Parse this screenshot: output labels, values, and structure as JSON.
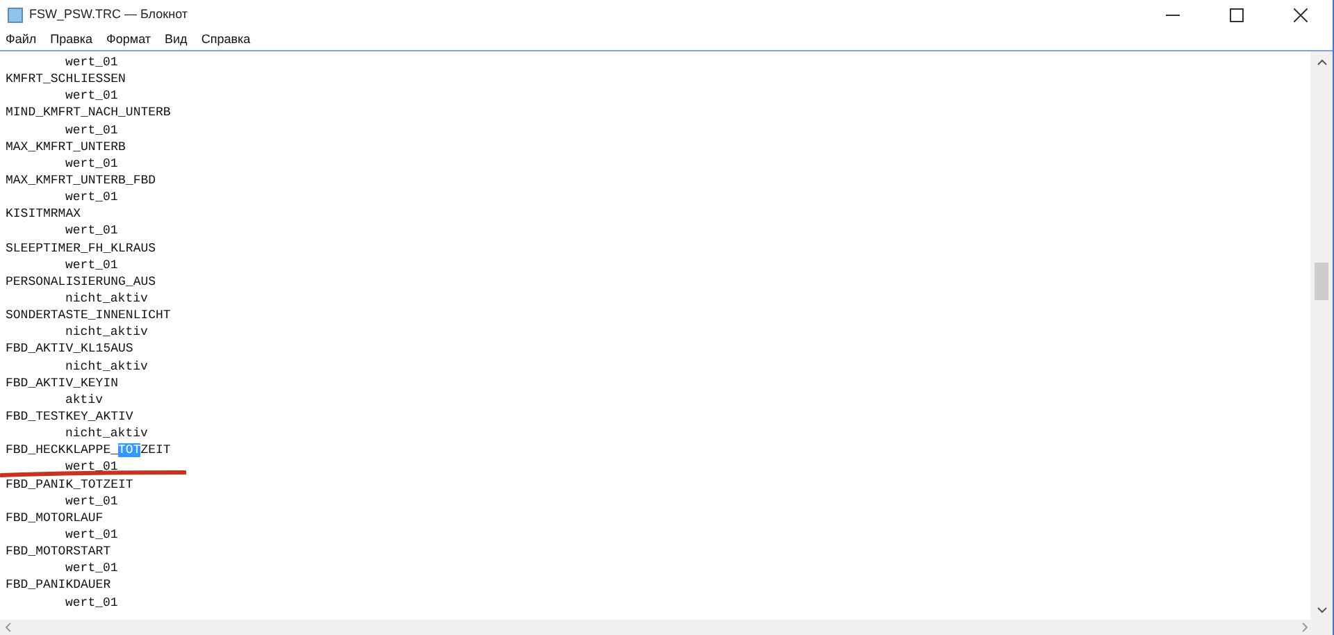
{
  "window": {
    "title": "FSW_PSW.TRC — Блокнот"
  },
  "menu": [
    "Файл",
    "Правка",
    "Формат",
    "Вид",
    "Справка"
  ],
  "lines": [
    {
      "indented": true,
      "marked": false,
      "segments": [
        {
          "text": "wert_01",
          "selected": false
        }
      ]
    },
    {
      "indented": false,
      "marked": false,
      "segments": [
        {
          "text": "KMFRT_SCHLIESSEN",
          "selected": false
        }
      ]
    },
    {
      "indented": true,
      "marked": false,
      "segments": [
        {
          "text": "wert_01",
          "selected": false
        }
      ]
    },
    {
      "indented": false,
      "marked": false,
      "segments": [
        {
          "text": "MIND_KMFRT_NACH_UNTERB",
          "selected": false
        }
      ]
    },
    {
      "indented": true,
      "marked": false,
      "segments": [
        {
          "text": "wert_01",
          "selected": false
        }
      ]
    },
    {
      "indented": false,
      "marked": false,
      "segments": [
        {
          "text": "MAX_KMFRT_UNTERB",
          "selected": false
        }
      ]
    },
    {
      "indented": true,
      "marked": false,
      "segments": [
        {
          "text": "wert_01",
          "selected": false
        }
      ]
    },
    {
      "indented": false,
      "marked": false,
      "segments": [
        {
          "text": "MAX_KMFRT_UNTERB_FBD",
          "selected": false
        }
      ]
    },
    {
      "indented": true,
      "marked": false,
      "segments": [
        {
          "text": "wert_01",
          "selected": false
        }
      ]
    },
    {
      "indented": false,
      "marked": false,
      "segments": [
        {
          "text": "KISITMRMAX",
          "selected": false
        }
      ]
    },
    {
      "indented": true,
      "marked": false,
      "segments": [
        {
          "text": "wert_01",
          "selected": false
        }
      ]
    },
    {
      "indented": false,
      "marked": false,
      "segments": [
        {
          "text": "SLEEPTIMER_FH_KLRAUS",
          "selected": false
        }
      ]
    },
    {
      "indented": true,
      "marked": false,
      "segments": [
        {
          "text": "wert_01",
          "selected": false
        }
      ]
    },
    {
      "indented": false,
      "marked": false,
      "segments": [
        {
          "text": "PERSONALISIERUNG_AUS",
          "selected": false
        }
      ]
    },
    {
      "indented": true,
      "marked": false,
      "segments": [
        {
          "text": "nicht_aktiv",
          "selected": false
        }
      ]
    },
    {
      "indented": false,
      "marked": false,
      "segments": [
        {
          "text": "SONDERTASTE_INNENLICHT",
          "selected": false
        }
      ]
    },
    {
      "indented": true,
      "marked": false,
      "segments": [
        {
          "text": "nicht_aktiv",
          "selected": false
        }
      ]
    },
    {
      "indented": false,
      "marked": false,
      "segments": [
        {
          "text": "FBD_AKTIV_KL15AUS",
          "selected": false
        }
      ]
    },
    {
      "indented": true,
      "marked": false,
      "segments": [
        {
          "text": "nicht_aktiv",
          "selected": false
        }
      ]
    },
    {
      "indented": false,
      "marked": false,
      "segments": [
        {
          "text": "FBD_AKTIV_KEYIN",
          "selected": false
        }
      ]
    },
    {
      "indented": true,
      "marked": false,
      "segments": [
        {
          "text": "aktiv",
          "selected": false
        }
      ]
    },
    {
      "indented": false,
      "marked": false,
      "segments": [
        {
          "text": "FBD_TESTKEY_AKTIV",
          "selected": false
        }
      ]
    },
    {
      "indented": true,
      "marked": false,
      "segments": [
        {
          "text": "nicht_aktiv",
          "selected": false
        }
      ]
    },
    {
      "indented": false,
      "marked": false,
      "segments": [
        {
          "text": "FBD_HECKKLAPPE_",
          "selected": false
        },
        {
          "text": "TOT",
          "selected": true
        },
        {
          "text": "ZEIT",
          "selected": false
        }
      ]
    },
    {
      "indented": true,
      "marked": true,
      "segments": [
        {
          "text": "wert_01",
          "selected": false
        }
      ]
    },
    {
      "indented": false,
      "marked": false,
      "segments": [
        {
          "text": "FBD_PANIK_TOTZEIT",
          "selected": false
        }
      ]
    },
    {
      "indented": true,
      "marked": false,
      "segments": [
        {
          "text": "wert_01",
          "selected": false
        }
      ]
    },
    {
      "indented": false,
      "marked": false,
      "segments": [
        {
          "text": "FBD_MOTORLAUF",
          "selected": false
        }
      ]
    },
    {
      "indented": true,
      "marked": false,
      "segments": [
        {
          "text": "wert_01",
          "selected": false
        }
      ]
    },
    {
      "indented": false,
      "marked": false,
      "segments": [
        {
          "text": "FBD_MOTORSTART",
          "selected": false
        }
      ]
    },
    {
      "indented": true,
      "marked": false,
      "segments": [
        {
          "text": "wert_01",
          "selected": false
        }
      ]
    },
    {
      "indented": false,
      "marked": false,
      "segments": [
        {
          "text": "FBD_PANIKDAUER",
          "selected": false
        }
      ]
    },
    {
      "indented": true,
      "marked": false,
      "segments": [
        {
          "text": "wert_01",
          "selected": false
        }
      ]
    }
  ]
}
